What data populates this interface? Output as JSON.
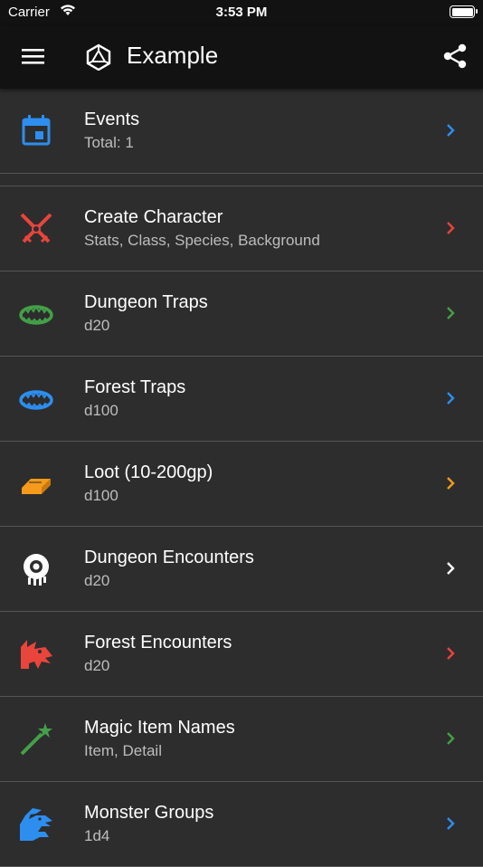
{
  "status_bar": {
    "carrier": "Carrier",
    "time": "3:53 PM"
  },
  "app_bar": {
    "title": "Example",
    "menu_icon": "hamburger-menu-icon",
    "logo_icon": "d20-die-icon",
    "share_icon": "share-icon"
  },
  "items": [
    {
      "title": "Events",
      "subtitle": "Total: 1",
      "icon": "calendar-icon",
      "color": "#2d8ef0"
    },
    {
      "title": "Create Character",
      "subtitle": "Stats, Class, Species, Background",
      "icon": "crossed-swords-icon",
      "color": "#e8453c"
    },
    {
      "title": "Dungeon Traps",
      "subtitle": "d20",
      "icon": "bear-trap-icon",
      "color": "#43a047"
    },
    {
      "title": "Forest Traps",
      "subtitle": "d100",
      "icon": "bear-trap-icon",
      "color": "#2d8ef0"
    },
    {
      "title": "Loot (10-200gp)",
      "subtitle": "d100",
      "icon": "gold-bar-icon",
      "color": "#f59a1b"
    },
    {
      "title": "Dungeon Encounters",
      "subtitle": "d20",
      "icon": "beholder-icon",
      "color": "#ffffff"
    },
    {
      "title": "Forest Encounters",
      "subtitle": "d20",
      "icon": "dragon-head-icon",
      "color": "#e8453c"
    },
    {
      "title": "Magic Item Names",
      "subtitle": "Item, Detail",
      "icon": "magic-wand-icon",
      "color": "#43a047"
    },
    {
      "title": "Monster Groups",
      "subtitle": "1d4",
      "icon": "hydra-icon",
      "color": "#2d8ef0"
    }
  ]
}
